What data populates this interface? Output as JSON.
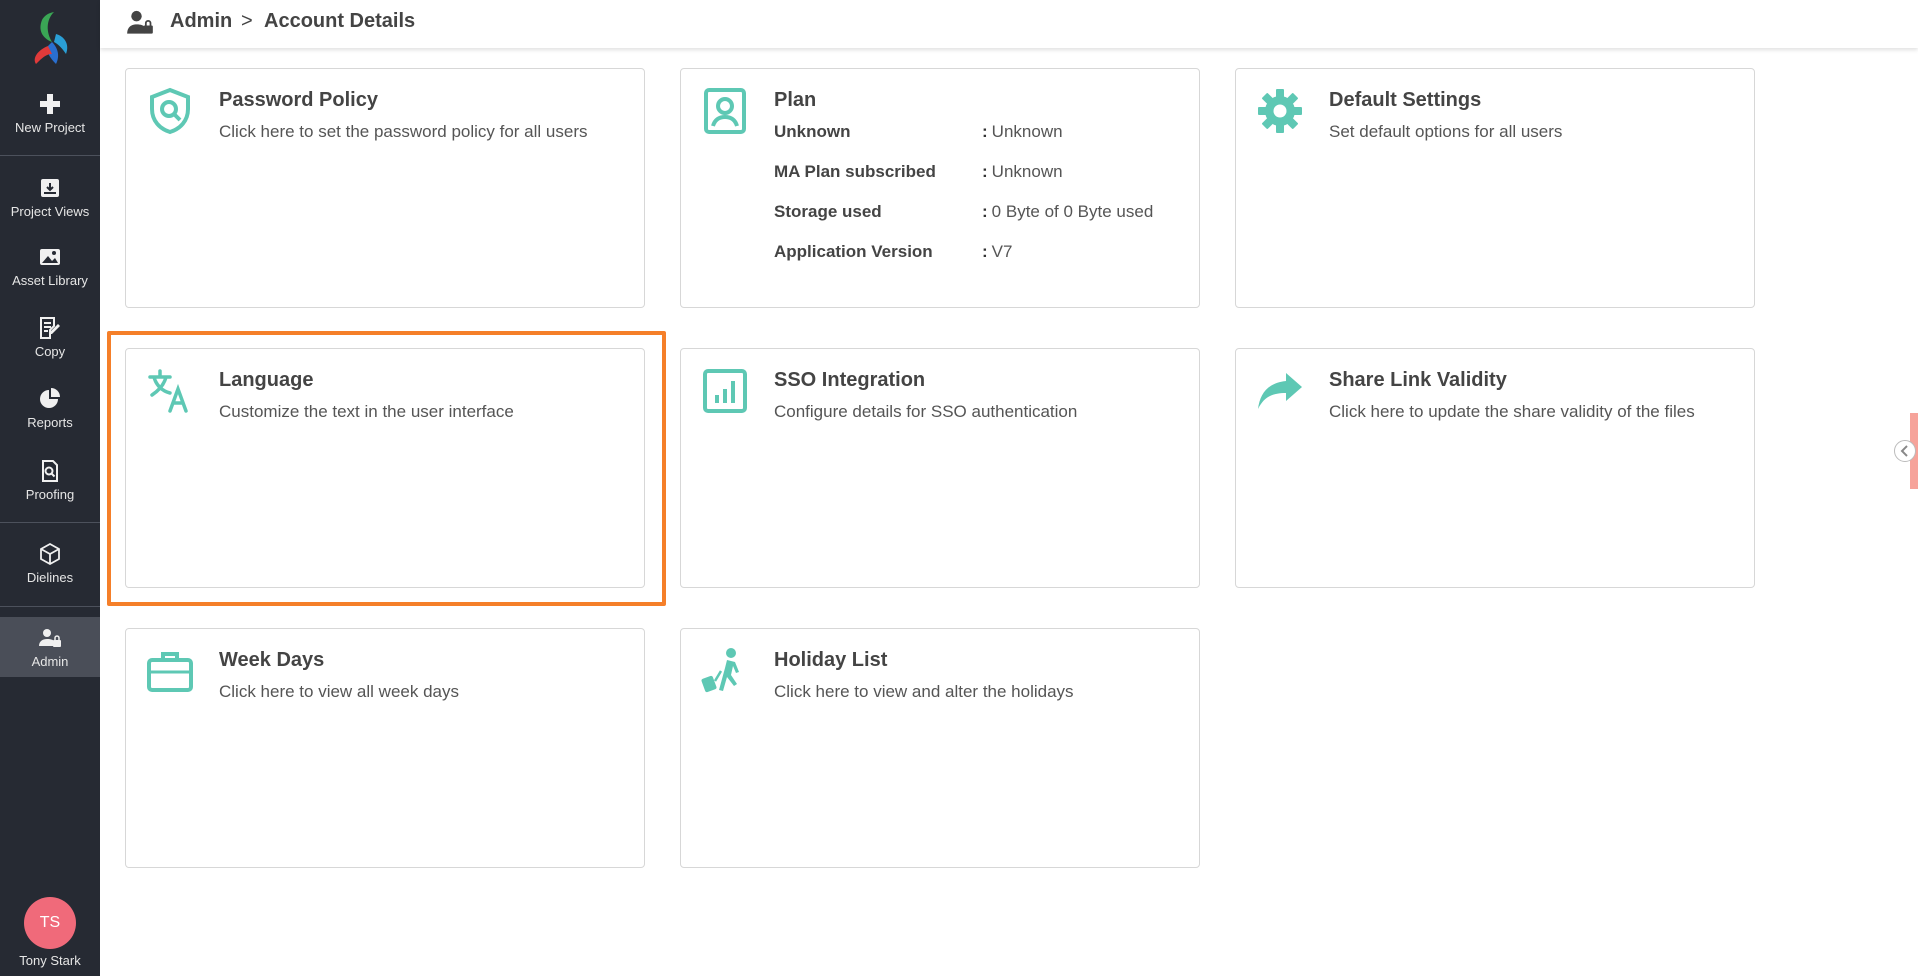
{
  "colors": {
    "accent": "#5ec8b4",
    "sidebar_bg": "#262a33",
    "highlight": "#f57f29",
    "avatar_bg": "#f06a7a"
  },
  "sidebar": {
    "items": [
      {
        "label": "New Project",
        "icon": "plus-icon"
      },
      {
        "label": "Project Views",
        "icon": "archive-icon"
      },
      {
        "label": "Asset Library",
        "icon": "image-icon"
      },
      {
        "label": "Copy",
        "icon": "edit-document-icon"
      },
      {
        "label": "Reports",
        "icon": "pie-chart-icon"
      },
      {
        "label": "Proofing",
        "icon": "proof-search-icon"
      },
      {
        "label": "Dielines",
        "icon": "box-icon"
      },
      {
        "label": "Admin",
        "icon": "user-lock-icon",
        "active": true
      }
    ],
    "user": {
      "initials": "TS",
      "name": "Tony Stark"
    }
  },
  "header": {
    "icon": "user-lock-icon",
    "breadcrumb": [
      "Admin",
      "Account Details"
    ],
    "separator": ">"
  },
  "cards": {
    "password_policy": {
      "title": "Password Policy",
      "description": "Click here to set the password policy for all users",
      "icon": "shield-search-icon"
    },
    "plan": {
      "title": "Plan",
      "icon": "user-portrait-icon",
      "rows": [
        {
          "key": "Unknown",
          "value": "Unknown"
        },
        {
          "key": "MA Plan subscribed",
          "value": "Unknown"
        },
        {
          "key": "Storage used",
          "value": "0 Byte of 0 Byte used"
        },
        {
          "key": "Application Version",
          "value": "V7"
        }
      ],
      "colon": ":"
    },
    "default_settings": {
      "title": "Default Settings",
      "description": "Set default options for all users",
      "icon": "gear-icon"
    },
    "language": {
      "title": "Language",
      "description": "Customize the text in the user interface",
      "icon": "translate-icon"
    },
    "sso": {
      "title": "SSO Integration",
      "description": "Configure details for SSO authentication",
      "icon": "bar-chart-square-icon"
    },
    "share_link": {
      "title": "Share Link Validity",
      "description": "Click here to update the share validity of the files",
      "icon": "share-arrow-icon"
    },
    "week_days": {
      "title": "Week Days",
      "description": "Click here to view all week days",
      "icon": "briefcase-icon"
    },
    "holiday_list": {
      "title": "Holiday List",
      "description": "Click here to view and alter the holidays",
      "icon": "traveler-icon"
    }
  }
}
